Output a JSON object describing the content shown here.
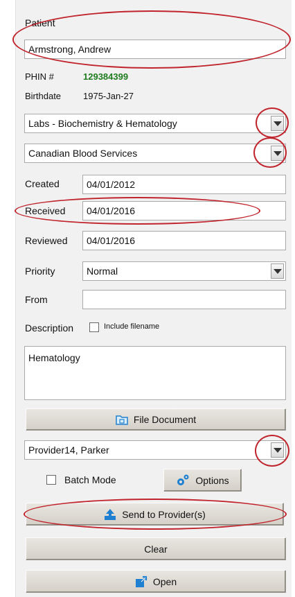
{
  "patient": {
    "label": "Patient",
    "name": "Armstrong, Andrew",
    "phin_label": "PHIN #",
    "phin": "129384399",
    "birthdate_label": "Birthdate",
    "birthdate": "1975-Jan-27"
  },
  "document_type": "Labs - Biochemistry & Hematology",
  "source": "Canadian Blood Services",
  "dates": {
    "created_label": "Created",
    "created": "04/01/2012",
    "received_label": "Received",
    "received": "04/01/2016",
    "reviewed_label": "Reviewed",
    "reviewed": "04/01/2016"
  },
  "priority": {
    "label": "Priority",
    "value": "Normal"
  },
  "from": {
    "label": "From",
    "value": ""
  },
  "description": {
    "label": "Description",
    "include_filename_label": "Include filename",
    "value": "Hematology"
  },
  "buttons": {
    "file_document": "File Document",
    "options": "Options",
    "send": "Send to Provider(s)",
    "clear": "Clear",
    "open": "Open"
  },
  "provider": "Provider14, Parker",
  "batch_mode_label": "Batch Mode",
  "colors": {
    "phin": "#1e7b1e",
    "highlight": "#c0232b",
    "icon_blue": "#1f7fd0"
  }
}
